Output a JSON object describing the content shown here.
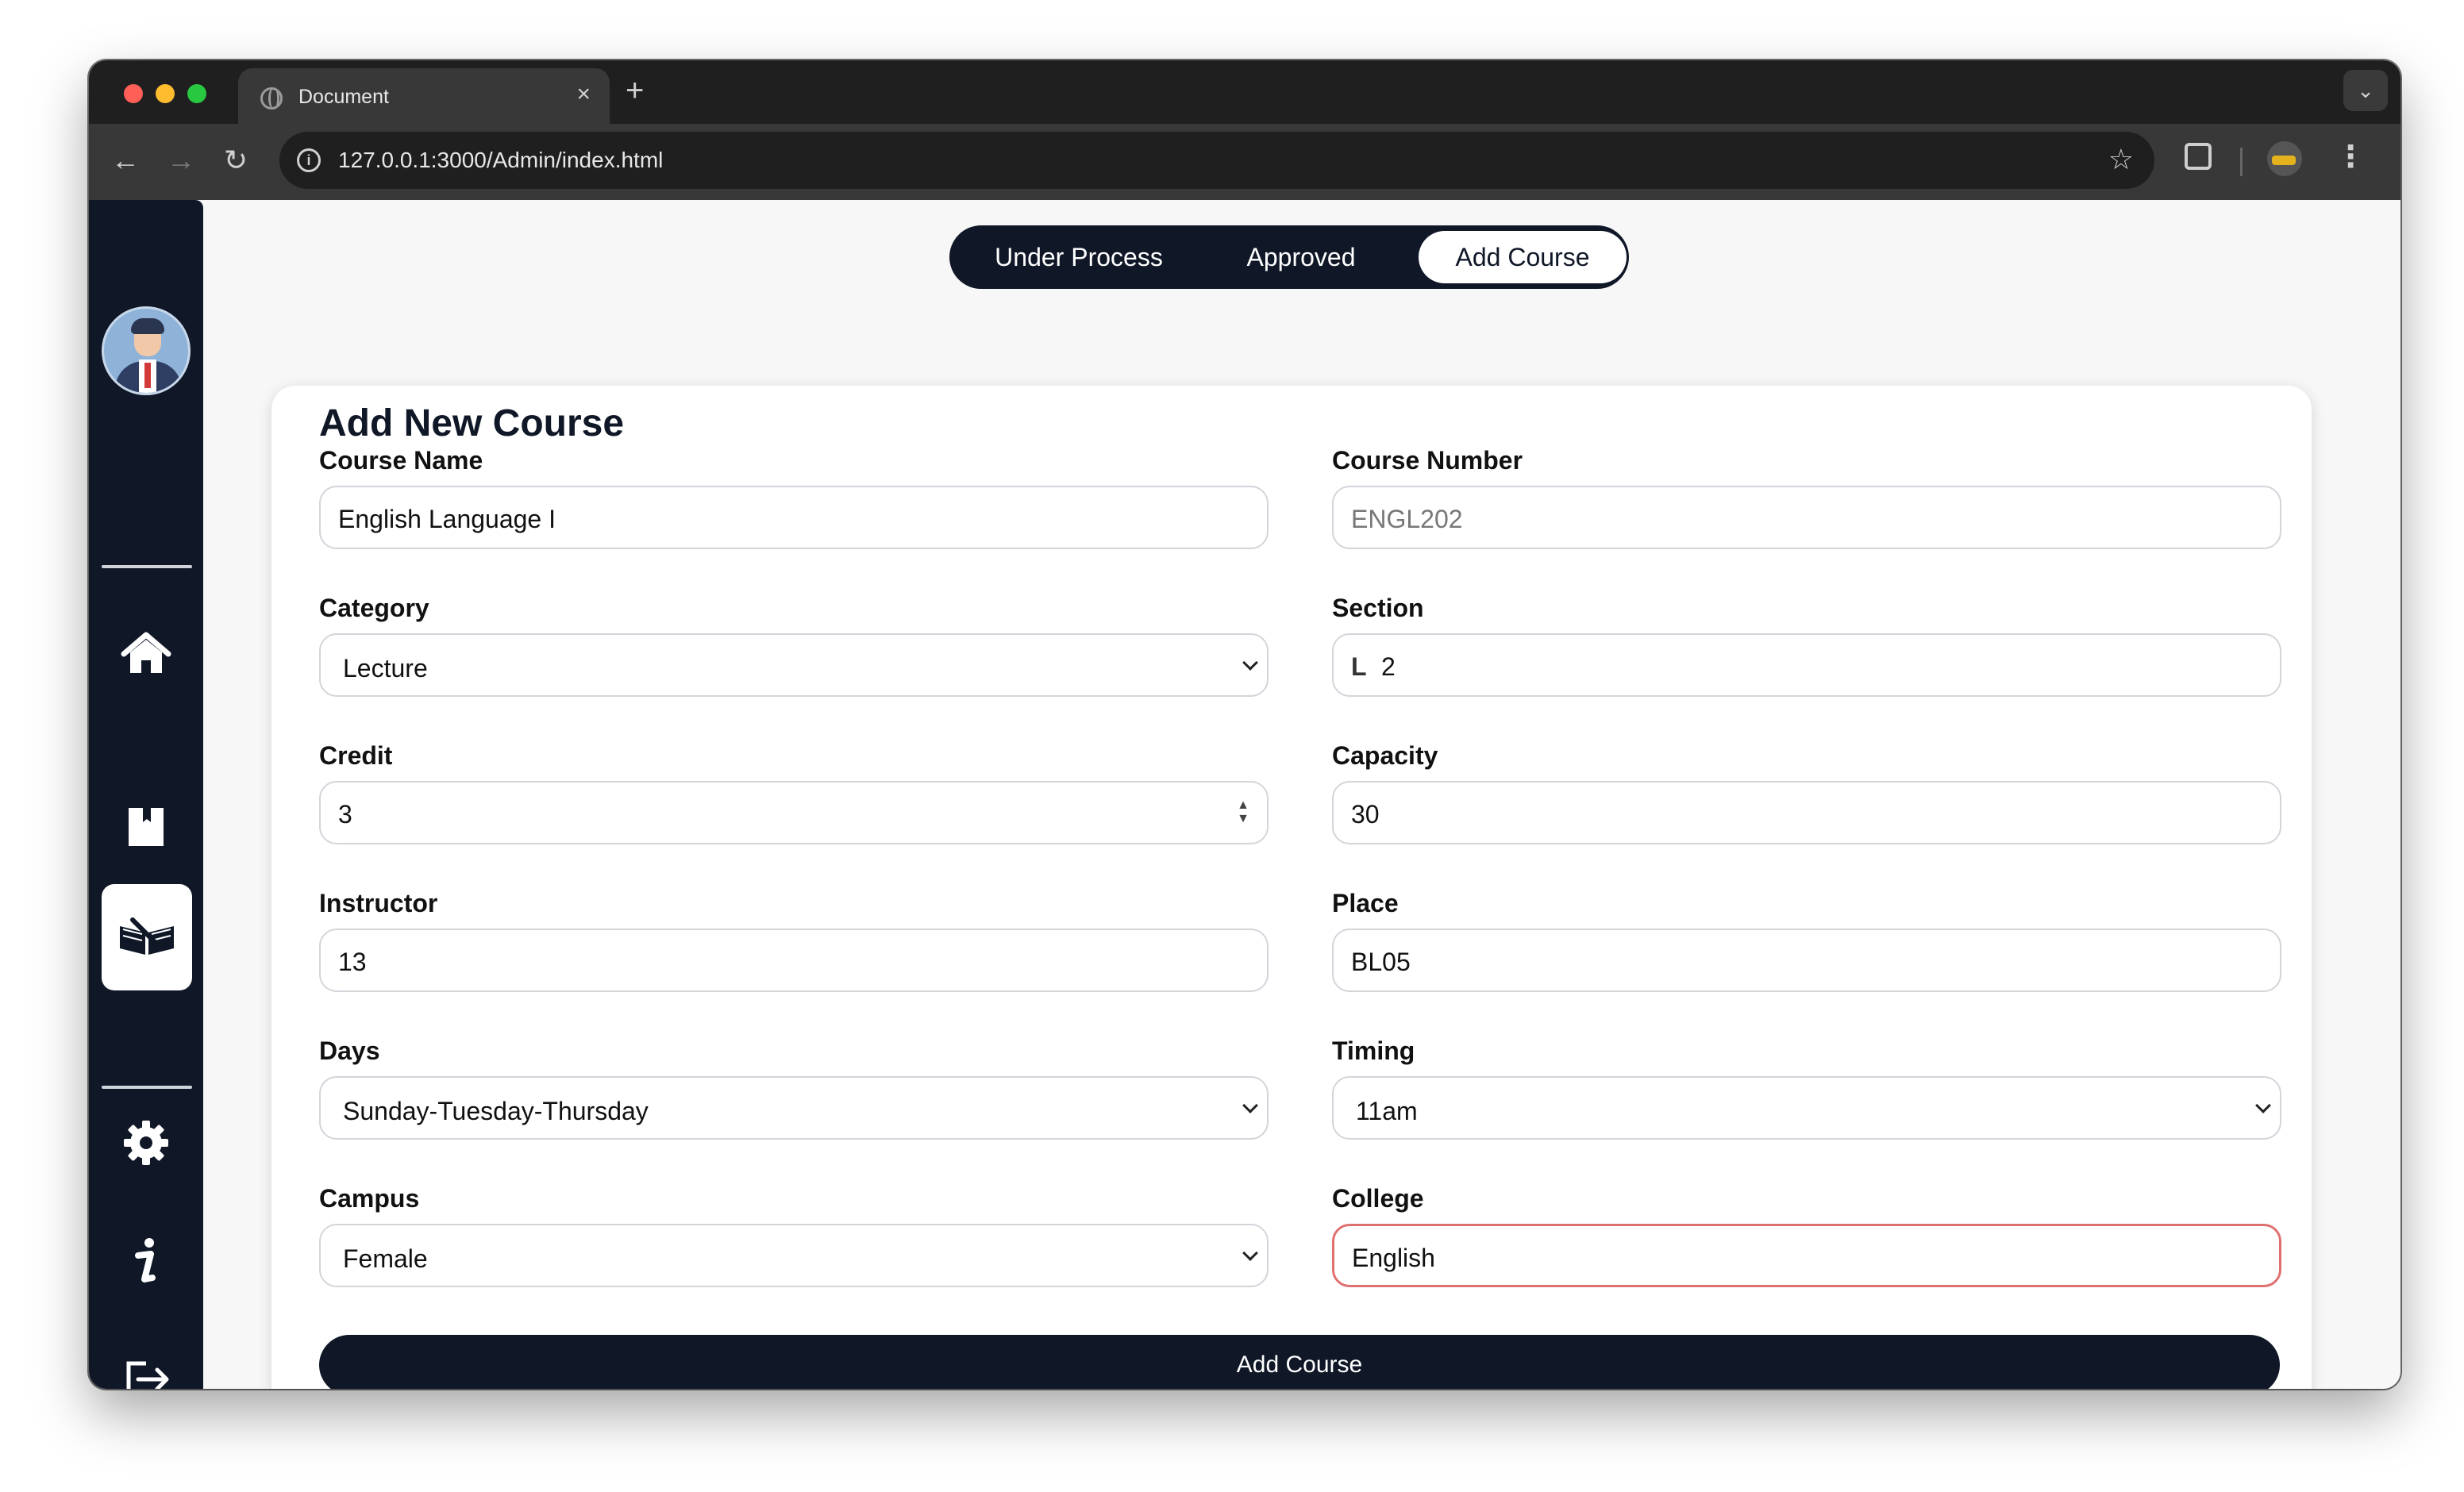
{
  "browser": {
    "tab_title": "Document",
    "tab_close": "×",
    "new_tab": "+",
    "dropdown": "⌄",
    "url": "127.0.0.1:3000/Admin/index.html",
    "back": "←",
    "forward": "→",
    "reload": "↻",
    "star": "☆",
    "menu": "⋮",
    "info": "i"
  },
  "sidebar": {
    "items": [
      {
        "icon": "home-icon"
      },
      {
        "icon": "bookmark-icon"
      },
      {
        "icon": "open-book-icon",
        "active": true
      },
      {
        "icon": "gear-icon"
      },
      {
        "icon": "info-icon"
      },
      {
        "icon": "logout-icon"
      }
    ]
  },
  "tabs": {
    "under_process": "Under Process",
    "approved": "Approved",
    "add_course": "Add Course",
    "active": "add_course"
  },
  "form": {
    "title": "Add New Course",
    "course_name": {
      "label": "Course Name",
      "value": "English Language I"
    },
    "course_number": {
      "label": "Course Number",
      "value": "ENGL202"
    },
    "category": {
      "label": "Category",
      "value": "Lecture"
    },
    "section": {
      "label": "Section",
      "prefix": "L",
      "value": "2"
    },
    "credit": {
      "label": "Credit",
      "value": "3"
    },
    "capacity": {
      "label": "Capacity",
      "value": "30"
    },
    "instructor": {
      "label": "Instructor",
      "value": "13"
    },
    "place": {
      "label": "Place",
      "value": "BL05"
    },
    "days": {
      "label": "Days",
      "value": "Sunday-Tuesday-Thursday"
    },
    "timing": {
      "label": "Timing",
      "value": "11am"
    },
    "campus": {
      "label": "Campus",
      "value": "Female"
    },
    "college": {
      "label": "College",
      "value": "English"
    },
    "submit": "Add Course"
  },
  "colors": {
    "sidebar_bg": "#101828",
    "error_border": "#e07070"
  }
}
